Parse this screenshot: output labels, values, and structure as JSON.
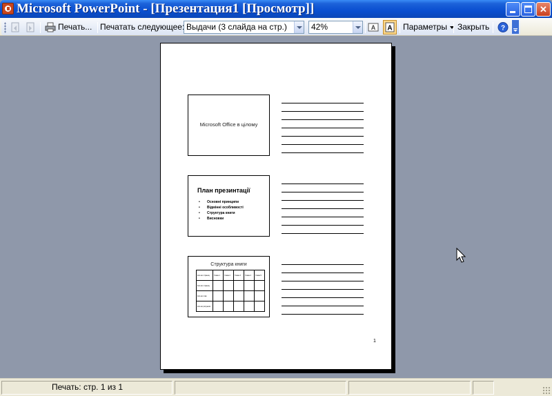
{
  "window": {
    "title": "Microsoft PowerPoint - [Презентация1 [Просмотр]]"
  },
  "toolbar": {
    "print_label": "Печать...",
    "print_what_label": "Печатать следующее:",
    "print_what_value": "Выдачи (3 слайда на стр.)",
    "zoom_value": "42%",
    "options_label": "Параметры",
    "close_label": "Закрыть"
  },
  "page": {
    "slides": [
      {
        "title": "Microsoft Office в цілому"
      },
      {
        "title": "План презинтації",
        "bullets": [
          "Основні принципи",
          "Відмінні особливості",
          "Структура книги",
          "Висновки"
        ]
      },
      {
        "title": "Структура книги",
        "table": [
          [
            "Кол-во страниц",
            "Глава 1",
            "Глава 2",
            "Глава 3",
            "Глава 4",
            "Глава 5"
          ],
          [
            "Кол-во страниц",
            "",
            "",
            "",
            "",
            ""
          ],
          [
            "Кол-во глав",
            "",
            "",
            "",
            "",
            ""
          ],
          [
            "Кол-во рисунков",
            "",
            "",
            "",
            "",
            ""
          ]
        ]
      }
    ],
    "page_number": "1"
  },
  "statusbar": {
    "page_text": "Печать: стр. 1 из 1"
  },
  "colors": {
    "background": "#8f98aa",
    "titlebar": "#0a4fd0",
    "statusbar": "#ece9d8"
  }
}
